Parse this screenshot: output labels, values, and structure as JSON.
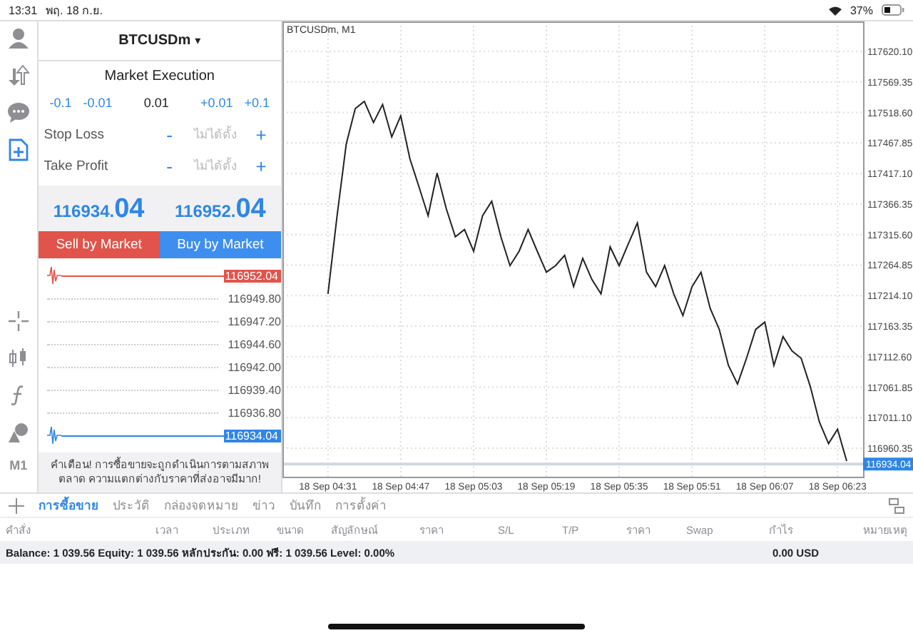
{
  "status_bar": {
    "time": "13:31",
    "date": "พฤ. 18 ก.ย.",
    "battery": "37%"
  },
  "rail": {
    "top": [
      {
        "kind": "account",
        "selected": false
      },
      {
        "kind": "quotes",
        "selected": false
      },
      {
        "kind": "chat",
        "selected": false
      },
      {
        "kind": "new_order",
        "selected": true
      }
    ],
    "bottom": [
      {
        "kind": "crosshair"
      },
      {
        "kind": "candles"
      },
      {
        "kind": "indicators"
      },
      {
        "kind": "objects"
      }
    ],
    "timeframe": "M1"
  },
  "order": {
    "symbol": "BTCUSDm",
    "caret": "▾",
    "mode": "Market Execution",
    "volume_steps": [
      "-0.1",
      "-0.01"
    ],
    "volume": "0.01",
    "volume_steps_up": [
      "+0.01",
      "+0.1"
    ],
    "fields": [
      {
        "label": "Stop Loss",
        "minus": "-",
        "placeholder": "ไม่ได้ตั้ง",
        "plus": "+"
      },
      {
        "label": "Take Profit",
        "minus": "-",
        "placeholder": "ไม่ได้ตั้ง",
        "plus": "+"
      }
    ],
    "bid": {
      "main": "116934.",
      "big": "04"
    },
    "ask": {
      "main": "116952.",
      "big": "04"
    },
    "sell": "Sell by Market",
    "buy": "Buy by Market",
    "ladder": {
      "ask": "116952.04",
      "levels": [
        "116949.80",
        "116947.20",
        "116944.60",
        "116942.00",
        "116939.40",
        "116936.80"
      ],
      "bid": "116934.04"
    },
    "warning": "คำเตือน! การซื้อขายจะถูกดำเนินการตามสภาพตลาด ความแตกต่างกับราคาที่ส่งอาจมีมาก!"
  },
  "chart": {
    "title": "BTCUSDm, M1",
    "chart_data": {
      "type": "line",
      "categories": [
        "18 Sep 04:31",
        null,
        null,
        null,
        null,
        null,
        null,
        null,
        "18 Sep 04:47",
        null,
        null,
        null,
        null,
        null,
        null,
        null,
        "18 Sep 05:03",
        null,
        null,
        null,
        null,
        null,
        null,
        null,
        "18 Sep 05:19",
        null,
        null,
        null,
        null,
        null,
        null,
        null,
        "18 Sep 05:35",
        null,
        null,
        null,
        null,
        null,
        null,
        null,
        "18 Sep 05:51",
        null,
        null,
        null,
        null,
        null,
        null,
        null,
        "18 Sep 06:07",
        null,
        null,
        null,
        null,
        null,
        null,
        null,
        "18 Sep 06:23",
        null
      ],
      "series": [
        {
          "color": "#222222",
          "values": [
            117217,
            117347,
            117466,
            117525,
            117537,
            117502,
            117532,
            117478,
            117513,
            117442,
            117395,
            117347,
            117418,
            117359,
            117312,
            117324,
            117288,
            117347,
            117371,
            117312,
            117264,
            117288,
            117324,
            117288,
            117253,
            117264,
            117281,
            117229,
            117276,
            117241,
            117217,
            117295,
            117264,
            117300,
            117335,
            117253,
            117229,
            117264,
            117217,
            117181,
            117229,
            117253,
            117193,
            117158,
            117098,
            117067,
            117110,
            117158,
            117170,
            117098,
            117146,
            117122,
            117110,
            117063,
            117004,
            116968,
            116992,
            116939
          ]
        }
      ],
      "ylim": [
        116913,
        117670
      ],
      "grid": true,
      "ref_lines": [
        {
          "axis": "y",
          "value": 116934.04,
          "label": "116934.04"
        }
      ],
      "yticks": [
        {
          "value": 117620.1,
          "label": "117620.10"
        },
        {
          "value": 117569.35,
          "label": "117569.35"
        },
        {
          "value": 117518.6,
          "label": "117518.60"
        },
        {
          "value": 117467.85,
          "label": "117467.85"
        },
        {
          "value": 117417.1,
          "label": "117417.10"
        },
        {
          "value": 117366.35,
          "label": "117366.35"
        },
        {
          "value": 117315.6,
          "label": "117315.60"
        },
        {
          "value": 117264.85,
          "label": "117264.85"
        },
        {
          "value": 117214.1,
          "label": "117214.10"
        },
        {
          "value": 117163.35,
          "label": "117163.35"
        },
        {
          "value": 117112.6,
          "label": "117112.60"
        },
        {
          "value": 117061.85,
          "label": "117061.85"
        },
        {
          "value": 117011.1,
          "label": "117011.10"
        },
        {
          "value": 116960.35,
          "label": "116960.35"
        }
      ]
    }
  },
  "tabs": [
    {
      "label": "การซื้อขาย",
      "selected": true
    },
    {
      "label": "ประวัติ",
      "selected": false
    },
    {
      "label": "กล่องจดหมาย",
      "selected": false
    },
    {
      "label": "ข่าว",
      "selected": false
    },
    {
      "label": "บันทึก",
      "selected": false
    },
    {
      "label": "การตั้งค่า",
      "selected": false
    }
  ],
  "table": {
    "columns": [
      "คำสั่ง",
      "เวลา",
      "ประเภท",
      "ขนาด",
      "สัญลักษณ์",
      "ราคา",
      "S/L",
      "T/P",
      "ราคา",
      "Swap",
      "กำไร",
      "หมายเหตุ"
    ],
    "summary": "Balance: 1 039.56 Equity: 1 039.56 หลักประกัน: 0.00 ฟรี: 1 039.56 Level: 0.00%",
    "profit": "0.00  USD"
  }
}
